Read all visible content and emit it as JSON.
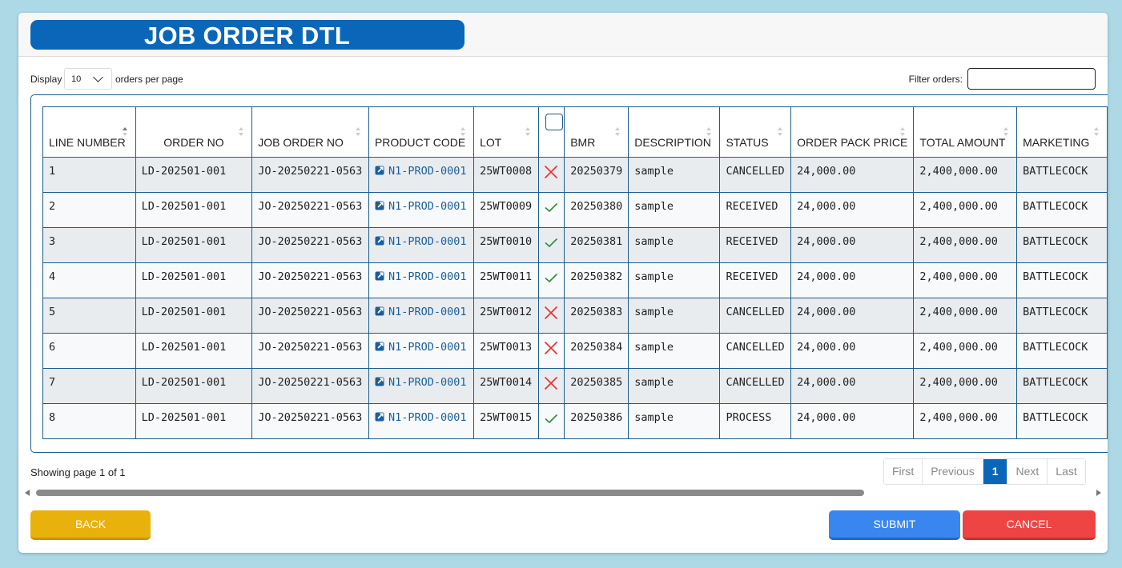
{
  "header": {
    "title": "JOB ORDER DTL"
  },
  "controls": {
    "display_label": "Display",
    "page_length": "10",
    "per_page_label": "orders per page",
    "filter_label": "Filter orders:",
    "filter_value": ""
  },
  "table": {
    "columns": [
      "LINE NUMBER",
      "ORDER NO",
      "JOB ORDER NO",
      "PRODUCT CODE",
      "LOT",
      "",
      "BMR",
      "DESCRIPTION",
      "STATUS",
      "ORDER PACK PRICE",
      "TOTAL AMOUNT",
      "MARKETING"
    ],
    "rows": [
      {
        "line": "1",
        "order_no": "LD-202501-001",
        "job_order_no": "JO-20250221-0563",
        "product_code": "N1-PROD-0001",
        "lot": "25WT0008",
        "check": "cross",
        "bmr": "20250379",
        "description": "sample",
        "status": "CANCELLED",
        "pack_price": "24,000.00",
        "total": "2,400,000.00",
        "marketing": "BATTLECOCK"
      },
      {
        "line": "2",
        "order_no": "LD-202501-001",
        "job_order_no": "JO-20250221-0563",
        "product_code": "N1-PROD-0001",
        "lot": "25WT0009",
        "check": "check",
        "bmr": "20250380",
        "description": "sample",
        "status": "RECEIVED",
        "pack_price": "24,000.00",
        "total": "2,400,000.00",
        "marketing": "BATTLECOCK"
      },
      {
        "line": "3",
        "order_no": "LD-202501-001",
        "job_order_no": "JO-20250221-0563",
        "product_code": "N1-PROD-0001",
        "lot": "25WT0010",
        "check": "check",
        "bmr": "20250381",
        "description": "sample",
        "status": "RECEIVED",
        "pack_price": "24,000.00",
        "total": "2,400,000.00",
        "marketing": "BATTLECOCK"
      },
      {
        "line": "4",
        "order_no": "LD-202501-001",
        "job_order_no": "JO-20250221-0563",
        "product_code": "N1-PROD-0001",
        "lot": "25WT0011",
        "check": "check",
        "bmr": "20250382",
        "description": "sample",
        "status": "RECEIVED",
        "pack_price": "24,000.00",
        "total": "2,400,000.00",
        "marketing": "BATTLECOCK"
      },
      {
        "line": "5",
        "order_no": "LD-202501-001",
        "job_order_no": "JO-20250221-0563",
        "product_code": "N1-PROD-0001",
        "lot": "25WT0012",
        "check": "cross",
        "bmr": "20250383",
        "description": "sample",
        "status": "CANCELLED",
        "pack_price": "24,000.00",
        "total": "2,400,000.00",
        "marketing": "BATTLECOCK"
      },
      {
        "line": "6",
        "order_no": "LD-202501-001",
        "job_order_no": "JO-20250221-0563",
        "product_code": "N1-PROD-0001",
        "lot": "25WT0013",
        "check": "cross",
        "bmr": "20250384",
        "description": "sample",
        "status": "CANCELLED",
        "pack_price": "24,000.00",
        "total": "2,400,000.00",
        "marketing": "BATTLECOCK"
      },
      {
        "line": "7",
        "order_no": "LD-202501-001",
        "job_order_no": "JO-20250221-0563",
        "product_code": "N1-PROD-0001",
        "lot": "25WT0014",
        "check": "cross",
        "bmr": "20250385",
        "description": "sample",
        "status": "CANCELLED",
        "pack_price": "24,000.00",
        "total": "2,400,000.00",
        "marketing": "BATTLECOCK"
      },
      {
        "line": "8",
        "order_no": "LD-202501-001",
        "job_order_no": "JO-20250221-0563",
        "product_code": "N1-PROD-0001",
        "lot": "25WT0015",
        "check": "check",
        "bmr": "20250386",
        "description": "sample",
        "status": "PROCESS",
        "pack_price": "24,000.00",
        "total": "2,400,000.00",
        "marketing": "BATTLECOCK"
      }
    ]
  },
  "footer": {
    "info": "Showing page 1 of 1",
    "pager": {
      "first": "First",
      "previous": "Previous",
      "current": "1",
      "next": "Next",
      "last": "Last"
    }
  },
  "buttons": {
    "back": "BACK",
    "submit": "SUBMIT",
    "cancel": "CANCEL"
  },
  "colors": {
    "brand": "#0a66b8",
    "check": "#2e8b3d",
    "cross": "#e53030",
    "back": "#e9b10b",
    "submit": "#3a86f0",
    "cancel": "#ee4444"
  }
}
